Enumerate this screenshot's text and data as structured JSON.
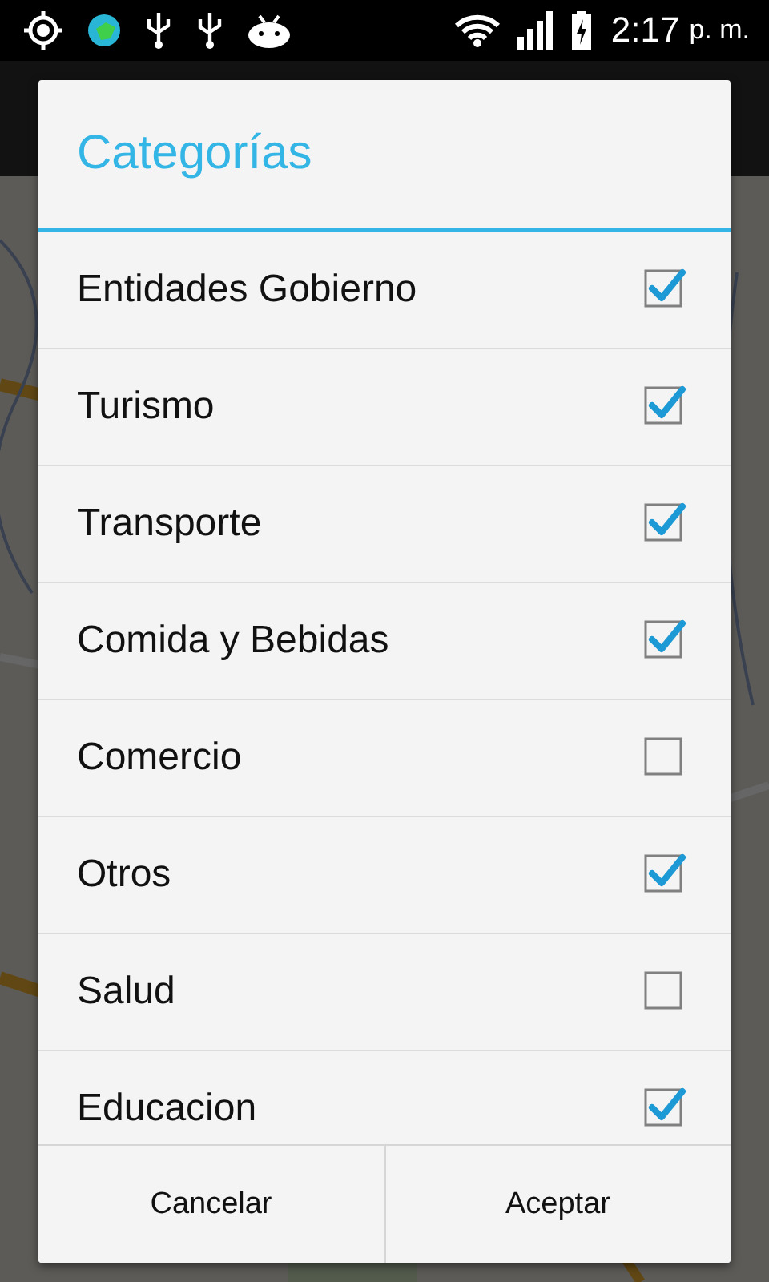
{
  "status_bar": {
    "time": "2:17",
    "period": "p. m."
  },
  "dialog": {
    "title": "Categorías",
    "items": [
      {
        "label": "Entidades Gobierno",
        "checked": true
      },
      {
        "label": "Turismo",
        "checked": true
      },
      {
        "label": "Transporte",
        "checked": true
      },
      {
        "label": "Comida y Bebidas",
        "checked": true
      },
      {
        "label": "Comercio",
        "checked": false
      },
      {
        "label": "Otros",
        "checked": true
      },
      {
        "label": "Salud",
        "checked": false
      },
      {
        "label": "Educacion",
        "checked": true
      }
    ],
    "buttons": [
      "Cancelar",
      "Aceptar"
    ]
  }
}
